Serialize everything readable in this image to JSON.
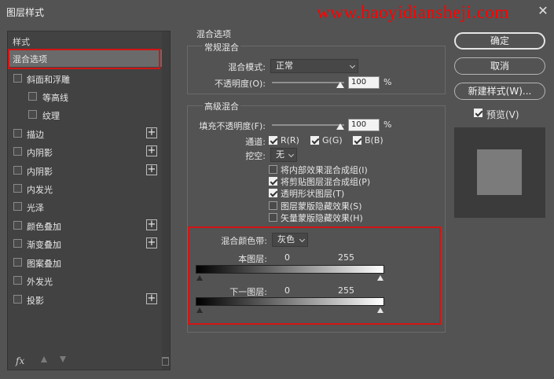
{
  "window": {
    "title": "图层样式",
    "watermark": "www.haoyidiansheji.com",
    "close": "✕"
  },
  "left": {
    "header": "样式",
    "items": [
      {
        "label": "混合选项",
        "selected": true
      },
      {
        "label": "斜面和浮雕",
        "checked": false
      },
      {
        "label": "等高线",
        "checked": false,
        "indent": true
      },
      {
        "label": "纹理",
        "checked": false,
        "indent": true
      },
      {
        "label": "描边",
        "checked": false,
        "plus": true
      },
      {
        "label": "内阴影",
        "checked": false,
        "plus": true
      },
      {
        "label": "内阴影",
        "checked": false,
        "plus": true
      },
      {
        "label": "内发光",
        "checked": false
      },
      {
        "label": "光泽",
        "checked": false
      },
      {
        "label": "颜色叠加",
        "checked": false,
        "plus": true
      },
      {
        "label": "渐变叠加",
        "checked": false,
        "plus": true
      },
      {
        "label": "图案叠加",
        "checked": false
      },
      {
        "label": "外发光",
        "checked": false
      },
      {
        "label": "投影",
        "checked": false,
        "plus": true
      }
    ],
    "fx_label": "fx"
  },
  "blend": {
    "section_title": "混合选项",
    "general": {
      "title": "常规混合",
      "mode_label": "混合模式:",
      "mode_value": "正常",
      "opacity_label": "不透明度(O):",
      "opacity_value": "100",
      "unit": "%"
    },
    "advanced": {
      "title": "高级混合",
      "fill_label": "填充不透明度(F):",
      "fill_value": "100",
      "unit": "%",
      "channels_label": "通道:",
      "channels": [
        {
          "label": "R(R)",
          "checked": true
        },
        {
          "label": "G(G)",
          "checked": true
        },
        {
          "label": "B(B)",
          "checked": true
        }
      ],
      "knockout_label": "挖空:",
      "knockout_value": "无",
      "options": [
        {
          "label": "将内部效果混合成组(I)",
          "checked": false
        },
        {
          "label": "将剪贴图层混合成组(P)",
          "checked": true
        },
        {
          "label": "透明形状图层(T)",
          "checked": true
        },
        {
          "label": "图层蒙版隐藏效果(S)",
          "checked": false
        },
        {
          "label": "矢量蒙版隐藏效果(H)",
          "checked": false
        }
      ]
    },
    "blend_if": {
      "label": "混合颜色带:",
      "value": "灰色",
      "this_layer_label": "本图层:",
      "this_low": "0",
      "this_high": "255",
      "under_layer_label": "下一图层:",
      "under_low": "0",
      "under_high": "255"
    }
  },
  "right": {
    "ok": "确定",
    "cancel": "取消",
    "new_style": "新建样式(W)...",
    "preview_label": "预览(V)",
    "preview_checked": true
  },
  "colors": {
    "highlight": "#d21414",
    "watermark": "#ff0000",
    "background": "#535353"
  }
}
